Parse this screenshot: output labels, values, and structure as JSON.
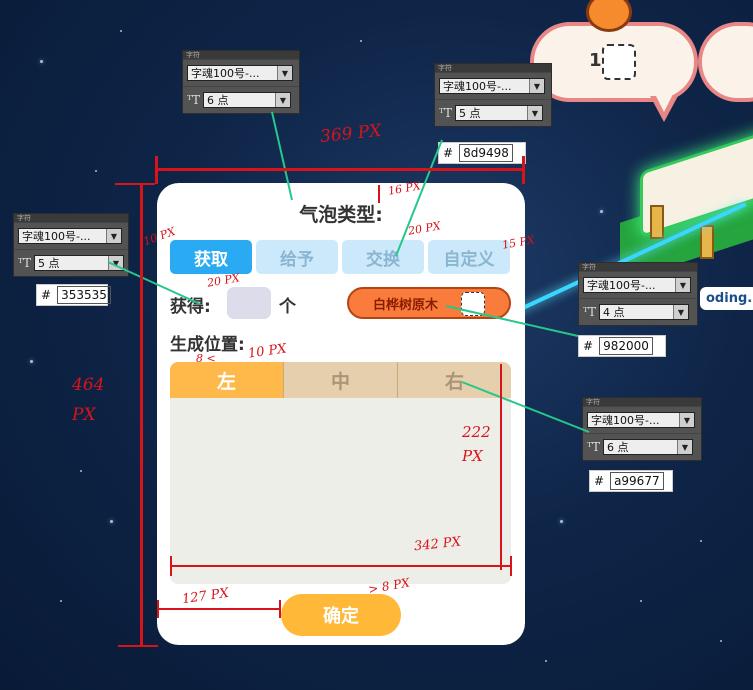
{
  "dialog": {
    "title": "气泡类型:",
    "tabs": [
      {
        "label": "获取",
        "active": true
      },
      {
        "label": "给予",
        "active": false
      },
      {
        "label": "交换",
        "active": false
      },
      {
        "label": "自定义",
        "active": false
      }
    ],
    "obtain_label": "获得:",
    "unit_label": "个",
    "item_label": "白桦树原木",
    "position_label": "生成位置:",
    "position_tabs": [
      {
        "label": "左",
        "active": true
      },
      {
        "label": "中",
        "active": false
      },
      {
        "label": "右",
        "active": false
      }
    ],
    "confirm_label": "确定"
  },
  "game": {
    "bubble_count": "1",
    "loading_text": "oding."
  },
  "ps_panels": [
    {
      "font": "字魂100号-...",
      "size": "6 点",
      "color": ""
    },
    {
      "font": "字魂100号-...",
      "size": "5 点",
      "color": "8d9498"
    },
    {
      "font": "字魂100号-...",
      "size": "5 点",
      "color": "353535"
    },
    {
      "font": "字魂100号-...",
      "size": "4 点",
      "color": "982000"
    },
    {
      "font": "字魂100号-...",
      "size": "6 点",
      "color": "a99677"
    }
  ],
  "hash": "#",
  "annotations": {
    "width_total": "369 PX",
    "height_total": "464 PX",
    "title_gap": "16 PX",
    "tab_gap": "20 PX",
    "margin_left": "10 PX",
    "margin_right": "15 PX",
    "row_gap": "20 PX",
    "label_gap": "10 PX",
    "small_gap": "8 <",
    "panel_height": "222 PX",
    "panel_width": "342 PX",
    "bottom_gap": "> 8 PX",
    "btn_offset": "127 PX"
  },
  "colors": {
    "tab_active": "#2aaaf2",
    "tab_inactive": "#cbe9fb",
    "item_pill": "#f97c3c",
    "item_text": "#982000",
    "position_active": "#ffb84a",
    "position_inactive": "#a99677",
    "confirm": "#ffb838"
  }
}
